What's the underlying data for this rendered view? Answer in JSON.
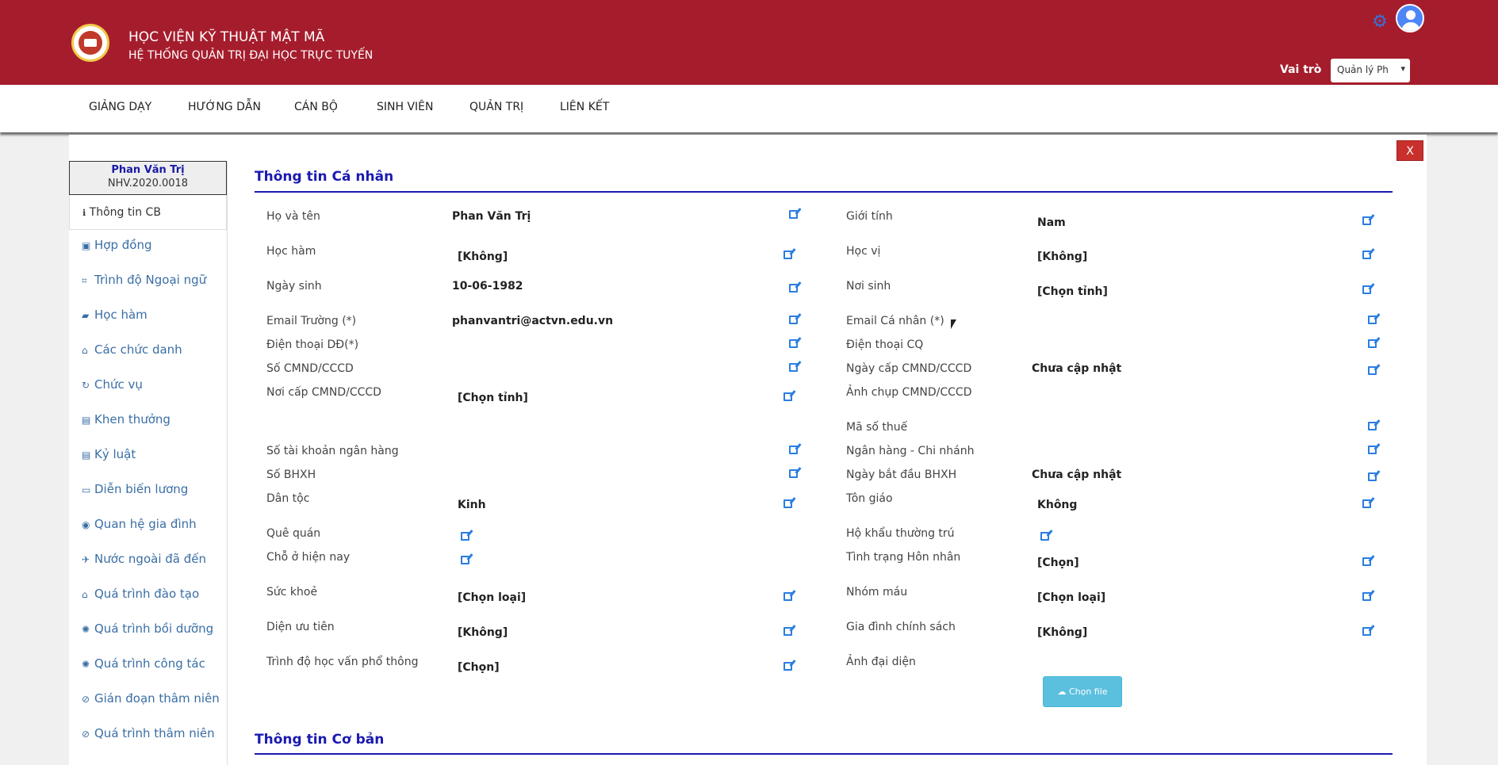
{
  "header": {
    "title": "HỌC VIỆN KỸ THUẬT MẬT MÃ",
    "subtitle": "HỆ THỐNG QUẢN TRỊ ĐẠI HỌC TRỰC TUYẾN",
    "role_label": "Vai trò",
    "role_value": "Quản lý Ph"
  },
  "nav": [
    "GIẢNG DẠY",
    "HƯỚNG DẪN",
    "CÁN BỘ",
    "SINH VIÊN",
    "QUẢN TRỊ",
    "LIÊN KẾT"
  ],
  "close_label": "X",
  "sidebar": {
    "name": "Phan Văn Trị",
    "code": "NHV.2020.0018",
    "active": "Thông tin CB",
    "items": [
      "Hợp đồng",
      "Trình độ Ngoại ngữ",
      "Học hàm",
      "Các chức danh",
      "Chức vụ",
      "Khen thưởng",
      "Kỷ luật",
      "Diễn biến lương",
      "Quan hệ gia đình",
      "Nước ngoài đã đến",
      "Quá trình đào tạo",
      "Quá trình bồi dưỡng",
      "Quá trình công tác",
      "Gián đoạn thâm niên",
      "Quá trình thâm niên"
    ]
  },
  "section_personal": "Thông tin Cá nhân",
  "section_basic": "Thông tin Cơ bản",
  "left_fields": [
    {
      "label": "Họ và tên",
      "value": "Phan Văn Trị"
    },
    {
      "label": "Học hàm",
      "value": "[Không]"
    },
    {
      "label": "Ngày sinh",
      "value": "10-06-1982"
    },
    {
      "label": "Email Trường (*)",
      "value": "phanvantri@actvn.edu.vn"
    },
    {
      "label": "Điện thoại DĐ(*)",
      "value": ""
    },
    {
      "label": "Số CMND/CCCD",
      "value": ""
    },
    {
      "label": "Nơi cấp CMND/CCCD",
      "value": "[Chọn tỉnh]"
    },
    {
      "label": "Số tài khoản ngân hàng",
      "value": ""
    },
    {
      "label": "Số BHXH",
      "value": ""
    },
    {
      "label": "Dân tộc",
      "value": "Kinh"
    },
    {
      "label": "Quê quán",
      "value": ""
    },
    {
      "label": "Chỗ ở hiện nay",
      "value": ""
    },
    {
      "label": "Sức khoẻ",
      "value": "[Chọn loại]"
    },
    {
      "label": "Diện ưu tiên",
      "value": "[Không]"
    },
    {
      "label": "Trình độ học vấn phổ thông",
      "value": "[Chọn]"
    }
  ],
  "right_fields": [
    {
      "label": "Giới tính",
      "value": "Nam"
    },
    {
      "label": "Học vị",
      "value": "[Không]"
    },
    {
      "label": "Nơi sinh",
      "value": "[Chọn tỉnh]"
    },
    {
      "label": "Email Cá nhân (*)",
      "value": ""
    },
    {
      "label": "Điện thoại CQ",
      "value": ""
    },
    {
      "label": "Ngày cấp CMND/CCCD",
      "value": "Chưa cập nhật"
    },
    {
      "label": "Ảnh chụp CMND/CCCD",
      "value": ""
    },
    {
      "label": "Mã số thuế",
      "value": ""
    },
    {
      "label": "Ngân hàng - Chi nhánh",
      "value": ""
    },
    {
      "label": "Ngày bắt đầu BHXH",
      "value": "Chưa cập nhật"
    },
    {
      "label": "Tôn giáo",
      "value": "Không"
    },
    {
      "label": "Hộ khẩu thường trú",
      "value": ""
    },
    {
      "label": "Tình trạng Hôn nhân",
      "value": "[Chọn]"
    },
    {
      "label": "Nhóm máu",
      "value": "[Chọn loại]"
    },
    {
      "label": "Gia đình chính sách",
      "value": "[Không]"
    },
    {
      "label": "Ảnh đại diện",
      "value": ""
    }
  ],
  "upload_label": "Chọn file",
  "colors": {
    "brand": "#a51d2d",
    "link": "#3a6ea5",
    "section": "#1a1ab0",
    "edit": "#2a7de1"
  }
}
